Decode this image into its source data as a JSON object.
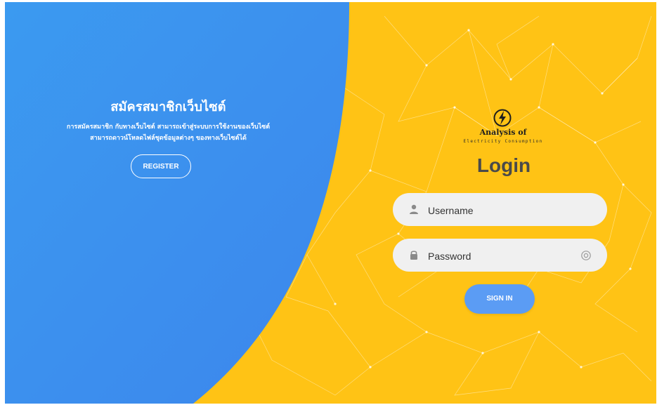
{
  "left_panel": {
    "title": "สมัครสมาชิกเว็บไซต์",
    "description_line1": "การสมัครสมาชิก กับทางเว็บไซต์ สามารถเข้าสู่ระบบการใช้งานของเว็บไซต์",
    "description_line2": "สามารถดาวน์โหลดไฟล์ชุดข้อมูลต่างๆ ของทางเว็บไซต์ได้",
    "register_label": "REGISTER"
  },
  "logo": {
    "icon": "lightning-bolt-icon",
    "title": "Analysis of",
    "subtitle": "Electricity Consumption"
  },
  "login": {
    "title": "Login",
    "username_placeholder": "Username",
    "username_value": "",
    "username_icon": "user-icon",
    "password_placeholder": "Password",
    "password_value": "",
    "password_icon": "lock-icon",
    "show_password_icon": "eye-icon",
    "signin_label": "SIGN IN"
  },
  "colors": {
    "blue_panel": "#3d92ee",
    "yellow_panel": "#ffc315",
    "signin_button": "#5b9cf4",
    "field_background": "#f0f0f0",
    "login_title": "#4a4a4a"
  }
}
